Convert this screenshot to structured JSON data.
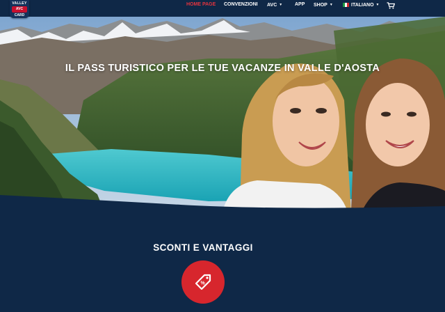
{
  "logo": {
    "line1": "VALLEY",
    "line2": "AVC",
    "line3": "CARD"
  },
  "nav": {
    "items": [
      {
        "label": "HOME PAGE",
        "active": true,
        "dropdown": false
      },
      {
        "label": "CONVENZIONI",
        "active": false,
        "dropdown": false
      },
      {
        "label": "AVC",
        "active": false,
        "dropdown": true
      },
      {
        "label": "APP",
        "active": false,
        "dropdown": false
      },
      {
        "label": "SHOP",
        "active": false,
        "dropdown": true
      }
    ],
    "language": {
      "label": "ITALIANO",
      "flag": "italy-flag-icon"
    },
    "cart_icon": "shopping-cart-icon"
  },
  "hero": {
    "headline": "IL PASS TURISTICO PER LE TUE VACANZE IN VALLE D'AOSTA"
  },
  "section": {
    "title": "SCONTI E VANTAGGI",
    "icon": "discount-tag-icon"
  },
  "colors": {
    "navy": "#0f2847",
    "active_red": "#e3343e",
    "button_red": "#d7262d"
  }
}
